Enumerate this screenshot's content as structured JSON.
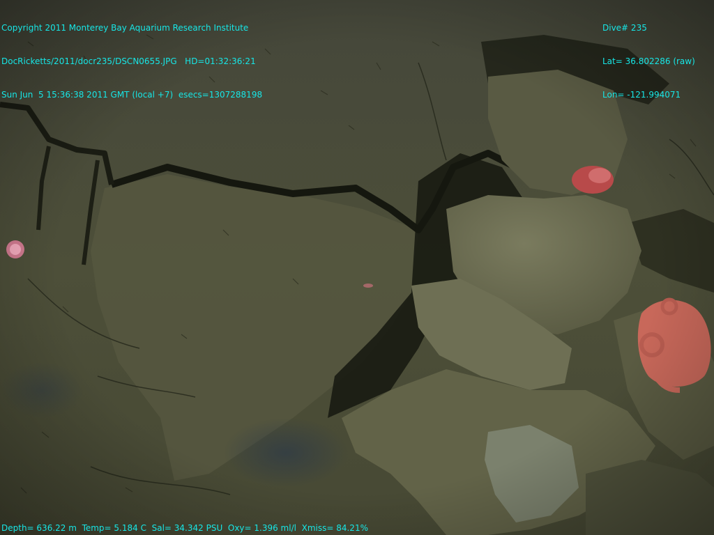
{
  "overlay": {
    "copyright": "Copyright 2011 Monterey Bay Aquarium Research Institute",
    "file_path": "DocRicketts/2011/docr235/DSCN0655.JPG",
    "hd_timecode": "HD=01:32:36:21",
    "datetime": "Sun Jun  5 15:36:38 2011 GMT (local +7)",
    "esecs": "esecs=1307288198",
    "dive": "Dive# 235",
    "lat": "Lat= 36.802286 (raw)",
    "lon": "Lon= -121.994071",
    "sensors": {
      "depth": "Depth= 636.22 m",
      "temp": "Temp= 5.184 C",
      "sal": "Sal= 34.342 PSU",
      "oxy": "Oxy= 1.396 ml/l",
      "xmiss": "Xmiss= 84.21%"
    }
  },
  "colors": {
    "overlay_text": "#17e6e6",
    "sediment": "#4a4c36",
    "rock": "#6a6b50",
    "shadow": "#14160f",
    "anemone": "#e07f9a",
    "octopus": "#c8685a"
  }
}
